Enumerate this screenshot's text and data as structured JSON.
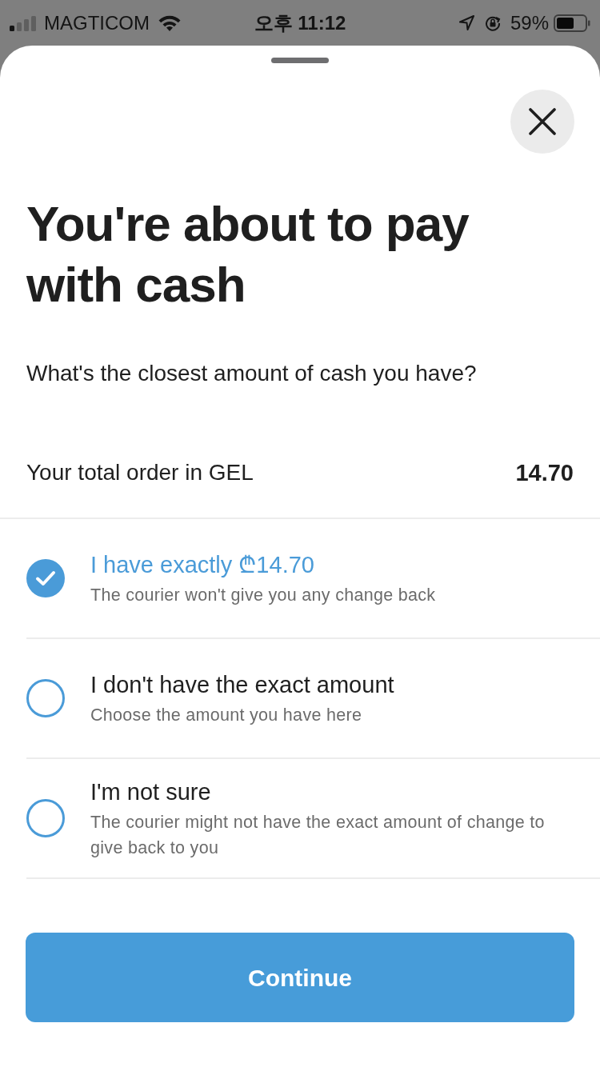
{
  "status_bar": {
    "carrier": "MAGTICOM",
    "time": "오후 11:12",
    "battery": "59%"
  },
  "sheet": {
    "title": "You're about to pay with cash",
    "prompt": "What's the closest amount of cash you have?",
    "total": {
      "label": "Your total order in GEL",
      "value": "14.70"
    },
    "options": [
      {
        "title": "I have exactly ₾14.70",
        "description": "The courier won't give you any change back",
        "selected": true
      },
      {
        "title": "I don't have the exact amount",
        "description": "Choose the amount you have here",
        "selected": false
      },
      {
        "title": "I'm not sure",
        "description": "The courier might not have the exact amount of change to give back to you",
        "selected": false
      }
    ],
    "continue_button": "Continue"
  }
}
